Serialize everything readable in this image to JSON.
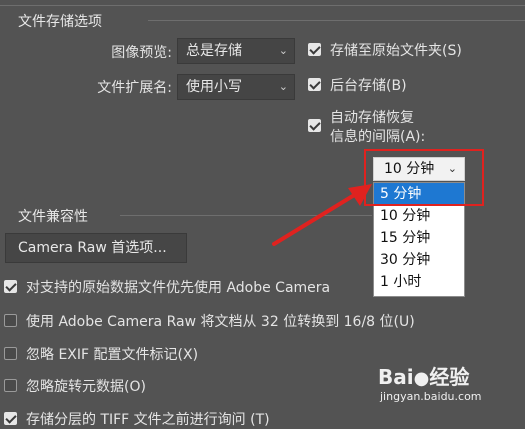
{
  "file_saving": {
    "title": "文件存储选项",
    "image_preview_label": "图像预览:",
    "image_preview_value": "总是存储",
    "extension_label": "文件扩展名:",
    "extension_value": "使用小写",
    "save_to_original_folder": "存储至原始文件夹(S)",
    "background_save": "后台存储(B)",
    "auto_save_line1": "自动存储恢复",
    "auto_save_line2": "信息的间隔(A):",
    "interval_value": "10 分钟",
    "interval_options": [
      "5 分钟",
      "10 分钟",
      "15 分钟",
      "30 分钟",
      "1 小时"
    ]
  },
  "compatibility": {
    "title": "文件兼容性",
    "camera_raw_button": "Camera Raw 首选项...",
    "prefer_camera_raw": "对支持的原始数据文件优先使用 Adobe Camera",
    "camera_raw_convert": "使用 Adobe Camera Raw 将文档从 32 位转换到 16/8 位(U)",
    "ignore_exif": "忽略 EXIF 配置文件标记(X)",
    "ignore_rotation": "忽略旋转元数据(O)",
    "ask_tiff": "存储分层的 TIFF 文件之前进行询问 (T)"
  },
  "watermark": {
    "brand": "Bai",
    "brand_suffix": "经验",
    "url": "jingyan.baidu.com"
  },
  "colors": {
    "background": "#535353",
    "highlight": "#1e78d2",
    "annotation": "#e0221f"
  }
}
